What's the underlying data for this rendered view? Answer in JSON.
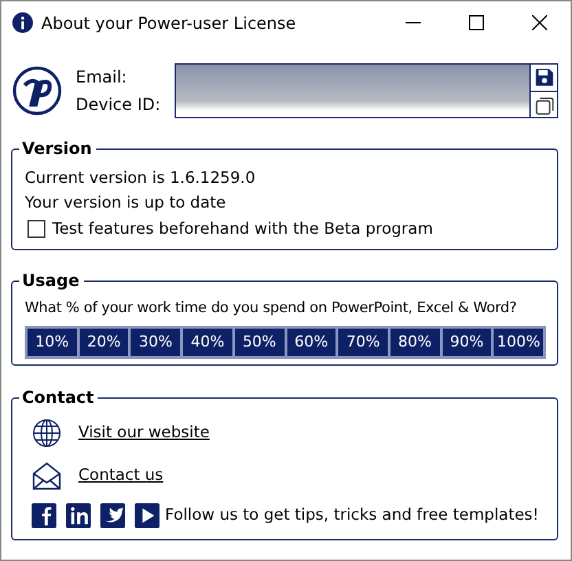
{
  "window": {
    "title": "About your Power-user License"
  },
  "license": {
    "labels": [
      "Email:",
      "Device ID:"
    ]
  },
  "version": {
    "title": "Version",
    "current": "Current version is 1.6.1259.0",
    "status": "Your version is up to date",
    "beta": {
      "label": "Test features beforehand with the Beta program",
      "checked": false
    }
  },
  "usage": {
    "title": "Usage",
    "question": "What % of your work time do you spend on PowerPoint, Excel & Word?",
    "options": [
      "10%",
      "20%",
      "30%",
      "40%",
      "50%",
      "60%",
      "70%",
      "80%",
      "90%",
      "100%"
    ]
  },
  "contact": {
    "title": "Contact",
    "links": [
      {
        "kind": "globe",
        "label": "Visit our website"
      },
      {
        "kind": "mail",
        "label": "Contact us"
      }
    ],
    "social": [
      {
        "kind": "facebook"
      },
      {
        "kind": "linkedin"
      },
      {
        "kind": "twitter"
      },
      {
        "kind": "youtube"
      }
    ],
    "follow": "Follow us to get tips, tricks and free templates!"
  }
}
